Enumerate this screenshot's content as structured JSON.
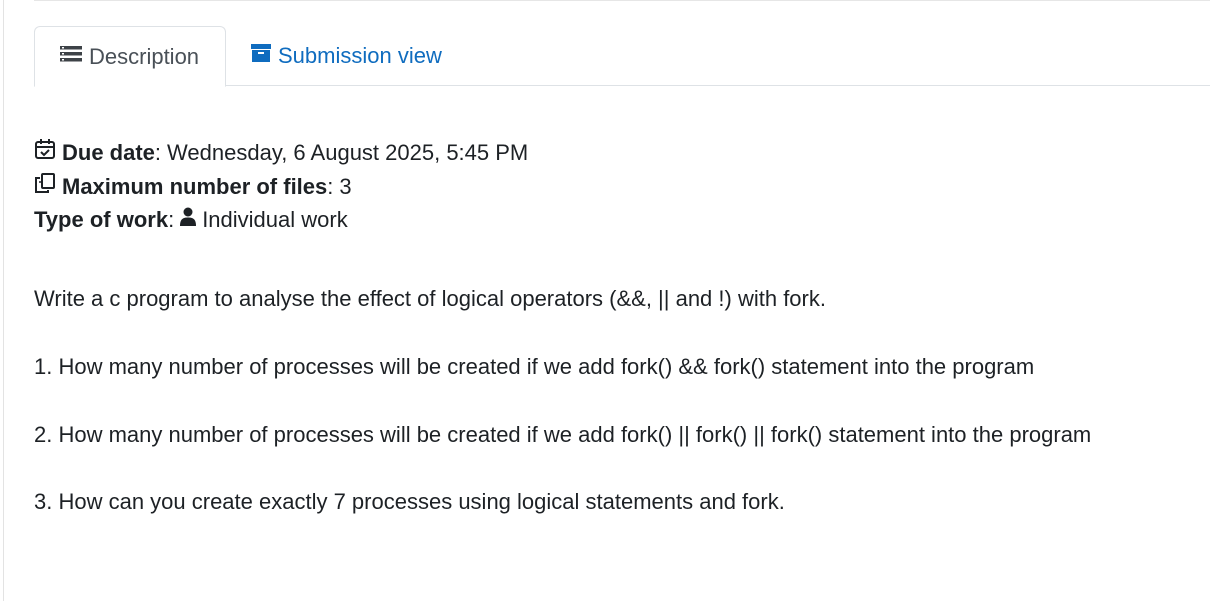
{
  "tabs": {
    "description_label": "Description",
    "submission_label": "Submission view"
  },
  "meta": {
    "due_date_label": "Due date",
    "due_date_value": "Wednesday, 6 August 2025, 5:45 PM",
    "max_files_label": "Maximum number of files",
    "max_files_value": "3",
    "work_type_label": "Type of work",
    "work_type_value": "Individual work",
    "separator": ":"
  },
  "description": {
    "intro": "Write a c program to analyse the effect of logical operators (&&, || and !) with fork.",
    "q1": "1. How many number of processes will be created if we add fork() && fork() statement into the program",
    "q2": "2. How many number of processes will be created if we add fork() || fork() || fork() statement into the program",
    "q3": "3. How can you create exactly 7 processes using logical statements and fork."
  },
  "icons": {
    "description_tab": "list-icon",
    "submission_tab": "archive-box-icon",
    "due_date": "calendar-check-icon",
    "max_files": "files-icon",
    "work_type": "user-icon"
  },
  "colors": {
    "link": "#0f6cbf",
    "text": "#1d2125",
    "tab_inactive_text": "#495057",
    "border": "#dee2e6"
  }
}
